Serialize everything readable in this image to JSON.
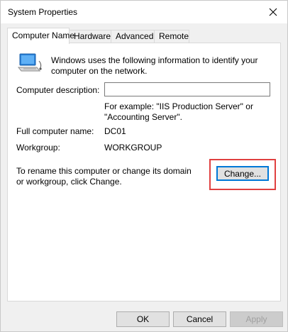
{
  "window": {
    "title": "System Properties"
  },
  "tabs": [
    {
      "label": "Computer Name",
      "active": true
    },
    {
      "label": "Hardware",
      "active": false
    },
    {
      "label": "Advanced",
      "active": false
    },
    {
      "label": "Remote",
      "active": false
    }
  ],
  "panel": {
    "intro": "Windows uses the following information to identify your computer on the network.",
    "description_label": "Computer description:",
    "description_value": "",
    "example_text": "For example: \"IIS Production Server\" or \"Accounting Server\".",
    "full_name_label": "Full computer name:",
    "full_name_value": "DC01",
    "workgroup_label": "Workgroup:",
    "workgroup_value": "WORKGROUP",
    "rename_text": "To rename this computer or change its domain or workgroup, click Change.",
    "change_button": "Change..."
  },
  "footer": {
    "ok": "OK",
    "cancel": "Cancel",
    "apply": "Apply"
  },
  "colors": {
    "highlight": "#e04040",
    "focus_border": "#0078d7"
  },
  "icons": {
    "computer": "computer-network-icon",
    "close": "close-icon"
  }
}
